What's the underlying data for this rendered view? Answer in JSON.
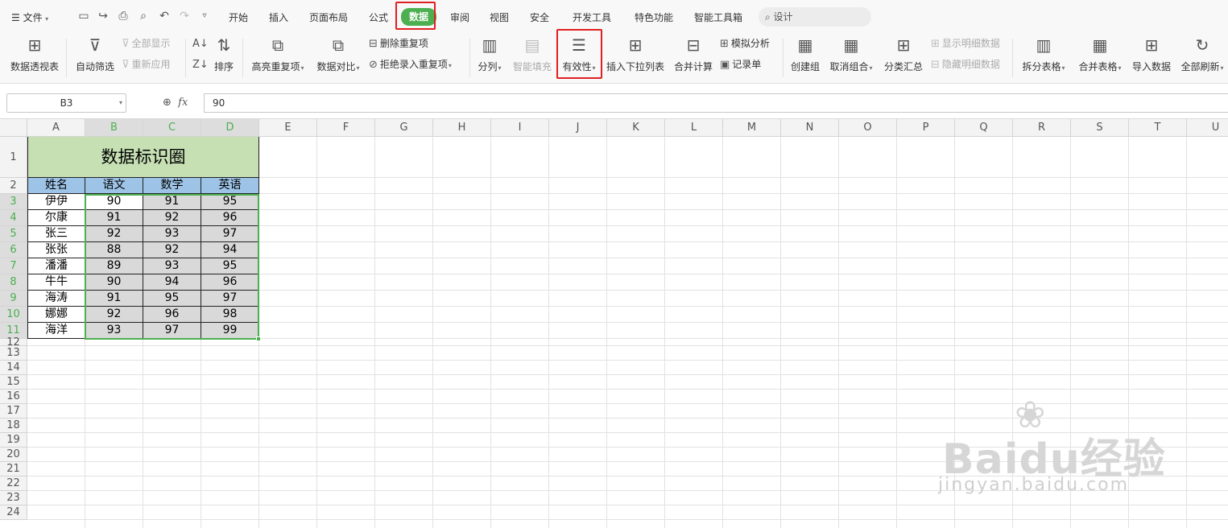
{
  "menubar": {
    "file_label": "文件",
    "tabs": [
      "开始",
      "插入",
      "页面布局",
      "公式",
      "数据",
      "审阅",
      "视图",
      "安全",
      "开发工具",
      "特色功能",
      "智能工具箱"
    ],
    "active_tab": "数据",
    "search_placeholder": "设计"
  },
  "ribbon": {
    "pivot": "数据透视表",
    "autofilter": "自动筛选",
    "show_all": "全部显示",
    "reapply": "重新应用",
    "sort": "排序",
    "highlight_dup": "高亮重复项",
    "compare": "数据对比",
    "remove_dup": "删除重复项",
    "reject_dup": "拒绝录入重复项",
    "split": "分列",
    "smart_fill": "智能填充",
    "validity": "有效性",
    "insert_dropdown": "插入下拉列表",
    "consolidate": "合并计算",
    "what_if": "模拟分析",
    "record_form": "记录单",
    "group": "创建组",
    "ungroup": "取消组合",
    "subtotal": "分类汇总",
    "show_detail": "显示明细数据",
    "hide_detail": "隐藏明细数据",
    "split_table": "拆分表格",
    "merge_table": "合并表格",
    "import_data": "导入数据",
    "refresh_all": "全部刷新"
  },
  "formula_bar": {
    "name_box": "B3",
    "fx": "fx",
    "value": "90"
  },
  "sheet": {
    "columns": [
      "A",
      "B",
      "C",
      "D",
      "E",
      "F",
      "G",
      "H",
      "I",
      "J",
      "K",
      "L",
      "M",
      "N",
      "O",
      "P",
      "Q",
      "R",
      "S",
      "T",
      "U"
    ],
    "rows": [
      "1",
      "2",
      "3",
      "4",
      "5",
      "6",
      "7",
      "8",
      "9",
      "10",
      "11",
      "12",
      "13",
      "14",
      "15",
      "16",
      "17",
      "18",
      "19",
      "20",
      "21",
      "22",
      "23",
      "24"
    ],
    "title": "数据标识圈",
    "headers": [
      "姓名",
      "语文",
      "数学",
      "英语"
    ],
    "data": [
      [
        "伊伊",
        "90",
        "91",
        "95"
      ],
      [
        "尔康",
        "91",
        "92",
        "96"
      ],
      [
        "张三",
        "92",
        "93",
        "97"
      ],
      [
        "张张",
        "88",
        "92",
        "94"
      ],
      [
        "潘潘",
        "89",
        "93",
        "95"
      ],
      [
        "牛牛",
        "90",
        "94",
        "96"
      ],
      [
        "海涛",
        "91",
        "95",
        "97"
      ],
      [
        "娜娜",
        "92",
        "96",
        "98"
      ],
      [
        "海洋",
        "93",
        "97",
        "99"
      ]
    ]
  },
  "watermark": {
    "brand": "Baidu经验",
    "url": "jingyan.baidu.com"
  },
  "colors": {
    "active_tab": "#4caf50",
    "highlight_box": "#e02020",
    "title_fill": "#c6e0b4",
    "header_fill": "#9dc3e6",
    "data_fill": "#d9d9d9",
    "selection": "#4caf50"
  }
}
